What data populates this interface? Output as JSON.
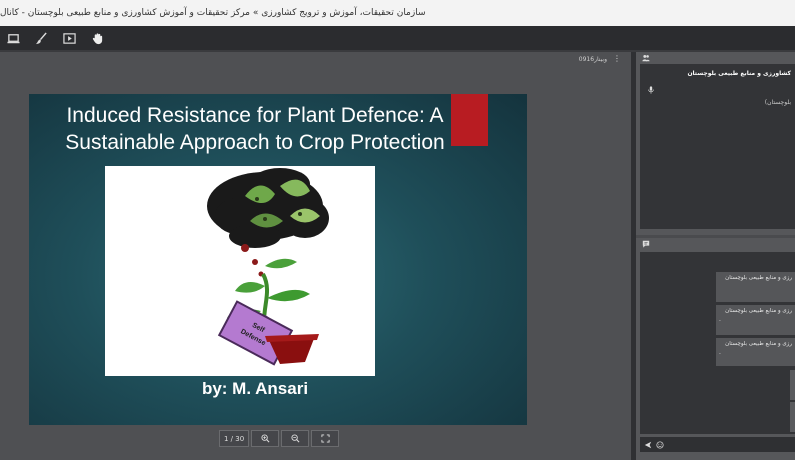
{
  "window": {
    "title": "سازمان تحقیقات، آموزش و ترویج کشاورزی » مرکز تحقیقات و آموزش کشاورزی و منابع طبیعی بلوچستان - کانال"
  },
  "toolbar": {
    "tools": [
      "laptop-icon",
      "brush-icon",
      "presentation-icon",
      "hand-icon"
    ]
  },
  "stage": {
    "header_label": "وبینار0916"
  },
  "slide": {
    "title": "Induced Resistance for Plant Defence: A Sustainable Approach to Crop Protection",
    "byline": "by: M. Ansari",
    "book_text": "Self Defense",
    "accent_color": "#b81c22"
  },
  "slide_controls": {
    "page": "1 / 30"
  },
  "users": {
    "name": "کشاورزی و منابع طبیعی بلوچستان",
    "sub": "بلوچستان)"
  },
  "chat": {
    "messages": [
      {
        "text": "رزی و منابع طبیعی بلوچستان",
        "dot": ""
      },
      {
        "text": "رزی و منابع طبیعی بلوچستان",
        "dot": "."
      },
      {
        "text": "رزی و منابع طبیعی بلوچستان",
        "dot": "."
      }
    ]
  }
}
